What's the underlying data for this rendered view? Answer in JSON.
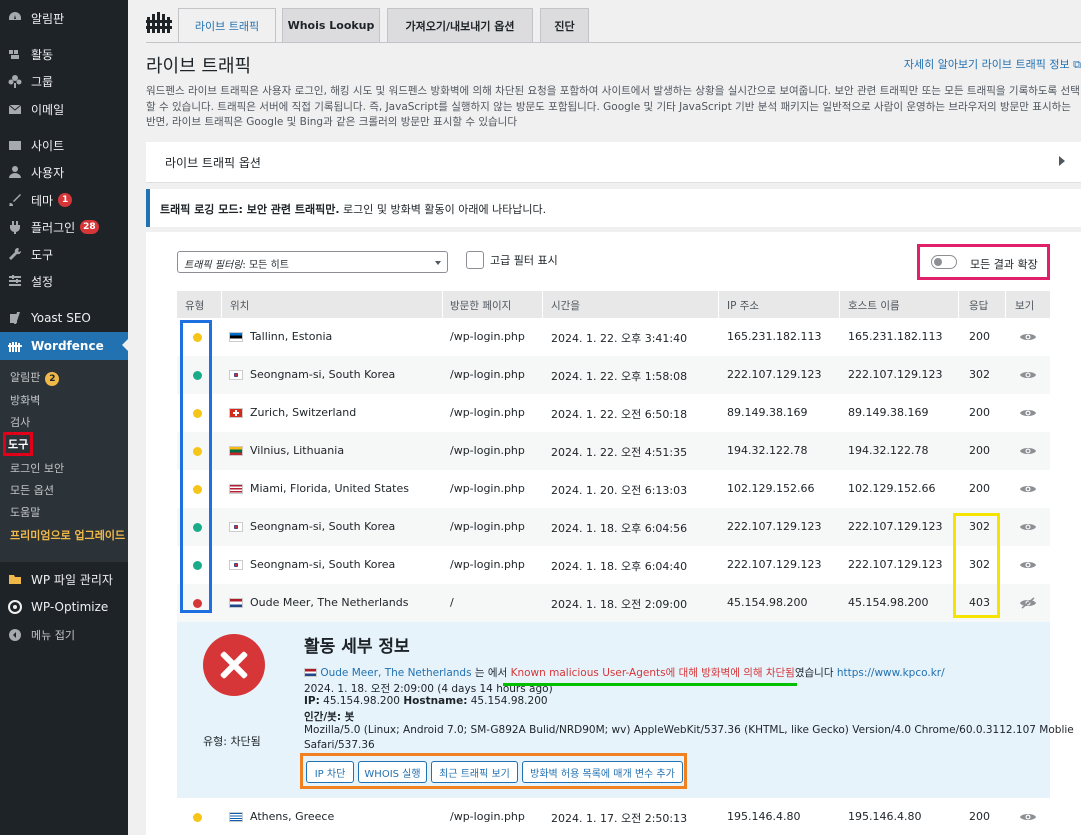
{
  "sidebar": {
    "items": [
      {
        "label": "알림판",
        "icon": "dashboard-icon",
        "badge": ""
      },
      {
        "label": "활동",
        "icon": "activity-icon",
        "badge": ""
      },
      {
        "label": "그룹",
        "icon": "groups-icon",
        "badge": ""
      },
      {
        "label": "이메일",
        "icon": "email-icon",
        "badge": ""
      },
      {
        "label": "사이트",
        "icon": "site-icon",
        "badge": ""
      },
      {
        "label": "사용자",
        "icon": "user-icon",
        "badge": ""
      },
      {
        "label": "테마",
        "icon": "brush-icon",
        "badge": "1"
      },
      {
        "label": "플러그인",
        "icon": "plugin-icon",
        "badge": "28"
      },
      {
        "label": "도구",
        "icon": "wrench-icon",
        "badge": ""
      },
      {
        "label": "설정",
        "icon": "settings-icon",
        "badge": ""
      },
      {
        "label": "Yoast SEO",
        "icon": "yoast-icon",
        "badge": ""
      },
      {
        "label": "Wordfence",
        "icon": "wordfence-icon",
        "badge": ""
      }
    ],
    "submenu": [
      {
        "label": "알림판",
        "badge": "2"
      },
      {
        "label": "방화벽"
      },
      {
        "label": "검사"
      },
      {
        "label": "도구"
      },
      {
        "label": "로그인 보안"
      },
      {
        "label": "모든 옵션"
      },
      {
        "label": "도움말"
      },
      {
        "label": "프리미엄으로 업그레이드"
      }
    ],
    "bottom": [
      {
        "label": "WP 파일 관리자",
        "icon": "folder-icon"
      },
      {
        "label": "WP-Optimize",
        "icon": "optimize-icon"
      },
      {
        "label": "메뉴 접기",
        "icon": "collapse-icon"
      }
    ]
  },
  "tabs": [
    "라이브 트래픽",
    "Whois Lookup",
    "가져오기/내보내기 옵션",
    "진단"
  ],
  "page": {
    "title": "라이브 트래픽",
    "learn_more": "자세히 알아보기 라이브 트래픽 정보",
    "description": "워드펜스 라이브 트래픽은 사용자 로그인, 해킹 시도 및 워드펜스 방화벽에 의해 차단된 요청을 포함하여 사이트에서 발생하는 상황을 실시간으로 보여줍니다. 보안 관련 트래픽만 또는 모든 트래픽을 기록하도록 선택할 수 있습니다. 트래픽은 서버에 직접 기록됩니다. 즉, JavaScript를 실행하지 않는 방문도 포함됩니다. Google 및 기타 JavaScript 기반 분석 패키지는 일반적으로 사람이 운영하는 브라우저의 방문만 표시하는 반면, 라이브 트래픽은 Google 및 Bing과 같은 크롤러의 방문만 표시할 수 있습니다",
    "options_title": "라이브 트래픽 옵션",
    "notice_bold": "트래픽 로깅 모드: 보안 관련 트래픽만.",
    "notice_rest": " 로그인 및 방화벽 활동이 아래에 나타납니다.",
    "filter_prefix": "트래픽 필터링",
    "filter_value": ": 모든 히트",
    "advanced_filter": "고급 필터 표시",
    "expand_all": "모든 결과 확장"
  },
  "table": {
    "headers": [
      "유형",
      "위치",
      "방문한 페이지",
      "시간을",
      "IP 주소",
      "호스트 이름",
      "응답",
      "보기"
    ],
    "rows": [
      {
        "type": "yellow",
        "flag": "ee",
        "location": "Tallinn, Estonia",
        "page": "/wp-login.php",
        "time": "2024. 1. 22. 오후 3:41:40",
        "ip": "165.231.182.113",
        "host": "165.231.182.113",
        "response": "200"
      },
      {
        "type": "green",
        "flag": "kr",
        "location": "Seongnam-si, South Korea",
        "page": "/wp-login.php",
        "time": "2024. 1. 22. 오후 1:58:08",
        "ip": "222.107.129.123",
        "host": "222.107.129.123",
        "response": "302"
      },
      {
        "type": "yellow",
        "flag": "ch",
        "location": "Zurich, Switzerland",
        "page": "/wp-login.php",
        "time": "2024. 1. 22. 오전 6:50:18",
        "ip": "89.149.38.169",
        "host": "89.149.38.169",
        "response": "200"
      },
      {
        "type": "yellow",
        "flag": "lt",
        "location": "Vilnius, Lithuania",
        "page": "/wp-login.php",
        "time": "2024. 1. 22. 오전 4:51:35",
        "ip": "194.32.122.78",
        "host": "194.32.122.78",
        "response": "200"
      },
      {
        "type": "yellow",
        "flag": "us",
        "location": "Miami, Florida, United States",
        "page": "/wp-login.php",
        "time": "2024. 1. 20. 오전 6:13:03",
        "ip": "102.129.152.66",
        "host": "102.129.152.66",
        "response": "200"
      },
      {
        "type": "green",
        "flag": "kr",
        "location": "Seongnam-si, South Korea",
        "page": "/wp-login.php",
        "time": "2024. 1. 18. 오후 6:04:56",
        "ip": "222.107.129.123",
        "host": "222.107.129.123",
        "response": "302"
      },
      {
        "type": "green",
        "flag": "kr",
        "location": "Seongnam-si, South Korea",
        "page": "/wp-login.php",
        "time": "2024. 1. 18. 오후 6:04:40",
        "ip": "222.107.129.123",
        "host": "222.107.129.123",
        "response": "302"
      },
      {
        "type": "red",
        "flag": "nl",
        "location": "Oude Meer, The Netherlands",
        "page": "/",
        "time": "2024. 1. 18. 오전 2:09:00",
        "ip": "45.154.98.200",
        "host": "45.154.98.200",
        "response": "403"
      }
    ],
    "last_row": {
      "type": "yellow",
      "flag": "gr",
      "location": "Athens, Greece",
      "page": "/wp-login.php",
      "time": "2024. 1. 17. 오전 2:50:13",
      "ip": "195.146.4.80",
      "host": "195.146.4.80",
      "response": "200"
    }
  },
  "detail": {
    "title": "활동 세부 정보",
    "type_label": "유형: 차단됨",
    "location": "Oude Meer, The Netherlands",
    "text_a": " 는 에서 ",
    "blocked_text": "Known malicious User-Agents에 대해 방화벽에 의해 차단됨",
    "text_b": "였습니다 ",
    "url": "https://www.kpco.kr/",
    "datetime": "2024. 1. 18. 오전 2:09:00 (4 days 14 hours ago)",
    "ip_label": "IP:",
    "ip": " 45.154.98.200 ",
    "host_label": "Hostname:",
    "host": " 45.154.98.200",
    "human_bot": "인간/봇: 봇",
    "ua1": "Mozilla/5.0 (Linux; Android 7.0; SM-G892A Bulid/NRD90M; wv) AppleWebKit/537.36 (KHTML, like Gecko) Version/4.0 Chrome/60.0.3112.107 Moblie",
    "ua2": "Safari/537.36",
    "buttons": [
      "IP 차단",
      "WHOIS 실행",
      "최근 트래픽 보기",
      "방화벽 허용 목록에 매개 변수 추가"
    ]
  },
  "colors": {
    "accent": "#2271b1",
    "dot_yellow": "#f5c518",
    "dot_green": "#1aab8a",
    "dot_red": "#d63638"
  }
}
